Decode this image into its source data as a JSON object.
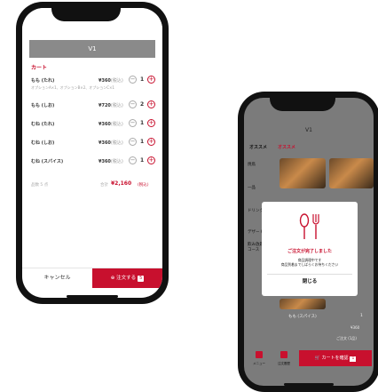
{
  "cart_screen": {
    "header_title": "V1",
    "cart_title": "カート",
    "items": [
      {
        "name": "もも (たれ)",
        "price": "¥360",
        "tax": "(税込)",
        "qty": "1",
        "options": "オプションA×1、オプションB×2、オプションC×1"
      },
      {
        "name": "もも (しお)",
        "price": "¥720",
        "tax": "(税込)",
        "qty": "2",
        "options": ""
      },
      {
        "name": "むね (たれ)",
        "price": "¥360",
        "tax": "(税込)",
        "qty": "1",
        "options": ""
      },
      {
        "name": "むね (しお)",
        "price": "¥360",
        "tax": "(税込)",
        "qty": "1",
        "options": ""
      },
      {
        "name": "むね (スパイス)",
        "price": "¥360",
        "tax": "(税込)",
        "qty": "1",
        "options": ""
      }
    ],
    "minus_glyph": "−",
    "plus_glyph": "+",
    "summary": {
      "count": "品数 5 点",
      "total_label": "合計",
      "total_value": "¥2,160",
      "total_tax": "(税込)"
    },
    "cancel_label": "キャンセル",
    "order_label": "注文する",
    "order_badge": "5"
  },
  "confirm_screen": {
    "header_title": "V1",
    "category_label": "オススメ",
    "category_active": "オススメ",
    "side_items": [
      "焼鳥",
      "一品",
      "ドリンク",
      "デザート",
      "飲み放題コース"
    ],
    "modal": {
      "title": "ご注文が完了しました",
      "line1": "商品調理中です",
      "line2": "商品到着までしばらくお待ちください",
      "close_label": "閉じる"
    },
    "row_name": "もも (スパイス)",
    "row_qty": "1",
    "row_price": "¥360",
    "row_count": "ご注文 (1品)",
    "tabs": [
      "メニュー",
      "注文履歴"
    ],
    "cart_button_label": "カートを確認",
    "cart_badge": "1"
  },
  "colors": {
    "accent": "#c8102e",
    "header_gray": "#8a8a8a",
    "overlay": "#7b7b7b"
  }
}
